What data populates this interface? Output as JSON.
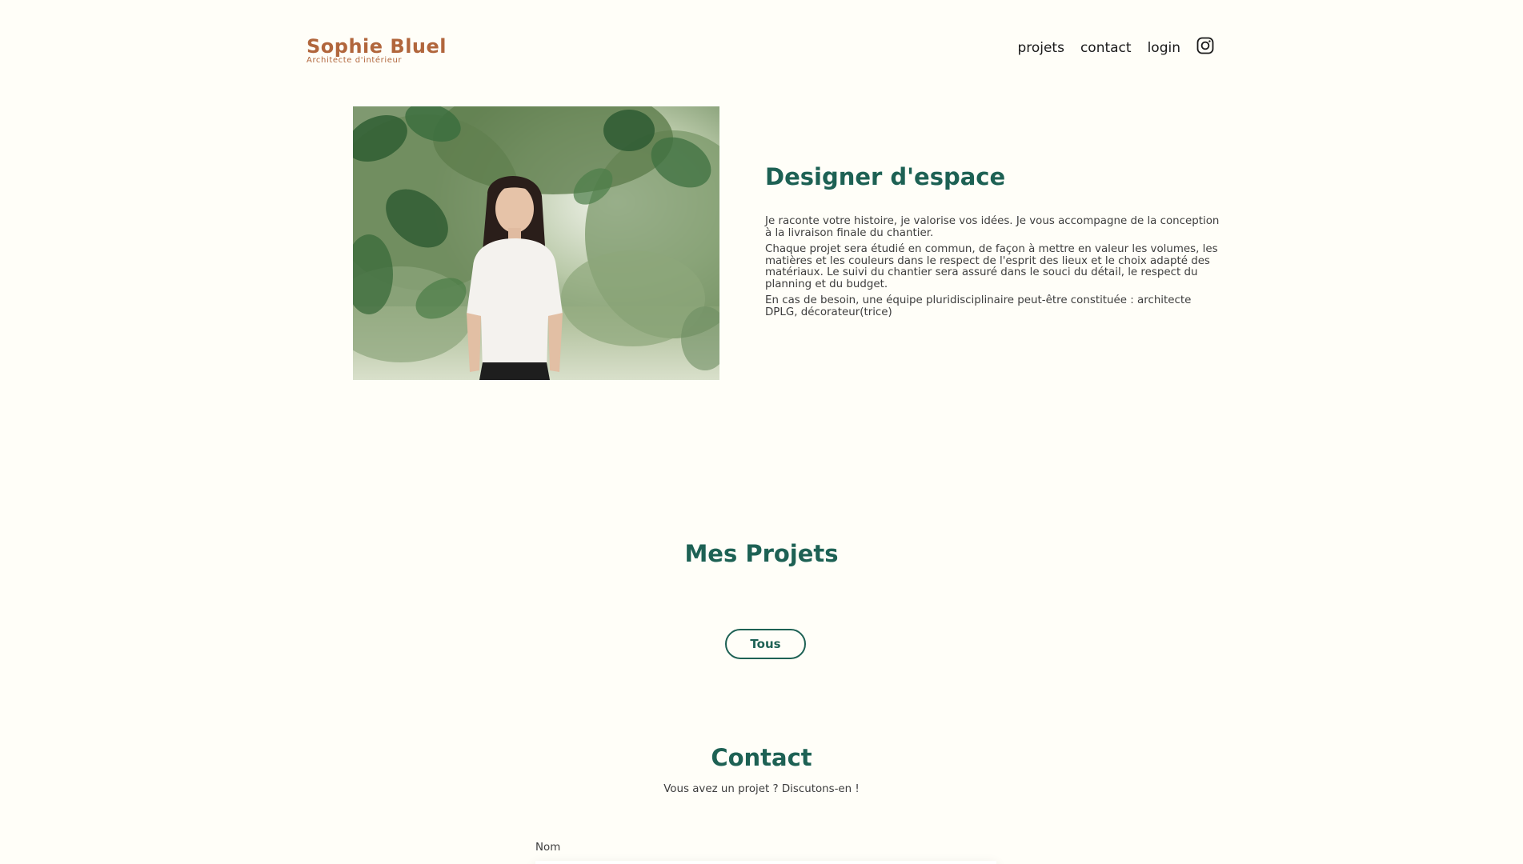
{
  "header": {
    "logo_title": "Sophie Bluel",
    "logo_subtitle": "Architecte d'intérieur",
    "nav": {
      "projets": "projets",
      "contact": "contact",
      "login": "login"
    },
    "instagram_icon": "instagram-icon"
  },
  "intro": {
    "title": "Designer d'espace",
    "paragraphs": [
      "Je raconte votre histoire, je valorise vos idées. Je vous accompagne de la conception à la livraison finale du chantier.",
      "Chaque projet sera étudié en commun, de façon à mettre en valeur les volumes, les matières et les couleurs dans le respect de l'esprit des lieux et le choix adapté des matériaux. Le suivi du chantier sera assuré dans le souci du détail, le respect du planning et du budget.",
      "En cas de besoin, une équipe pluridisciplinaire peut-être constituée : architecte DPLG, décorateur(trice)"
    ]
  },
  "projects": {
    "title": "Mes Projets",
    "filter_all": "Tous"
  },
  "contact": {
    "title": "Contact",
    "lead": "Vous avez un projet ? Discutons-en !",
    "name_label": "Nom"
  },
  "colors": {
    "background": "#FFFEF8",
    "brand": "#B1663C",
    "accent": "#1D6154"
  }
}
